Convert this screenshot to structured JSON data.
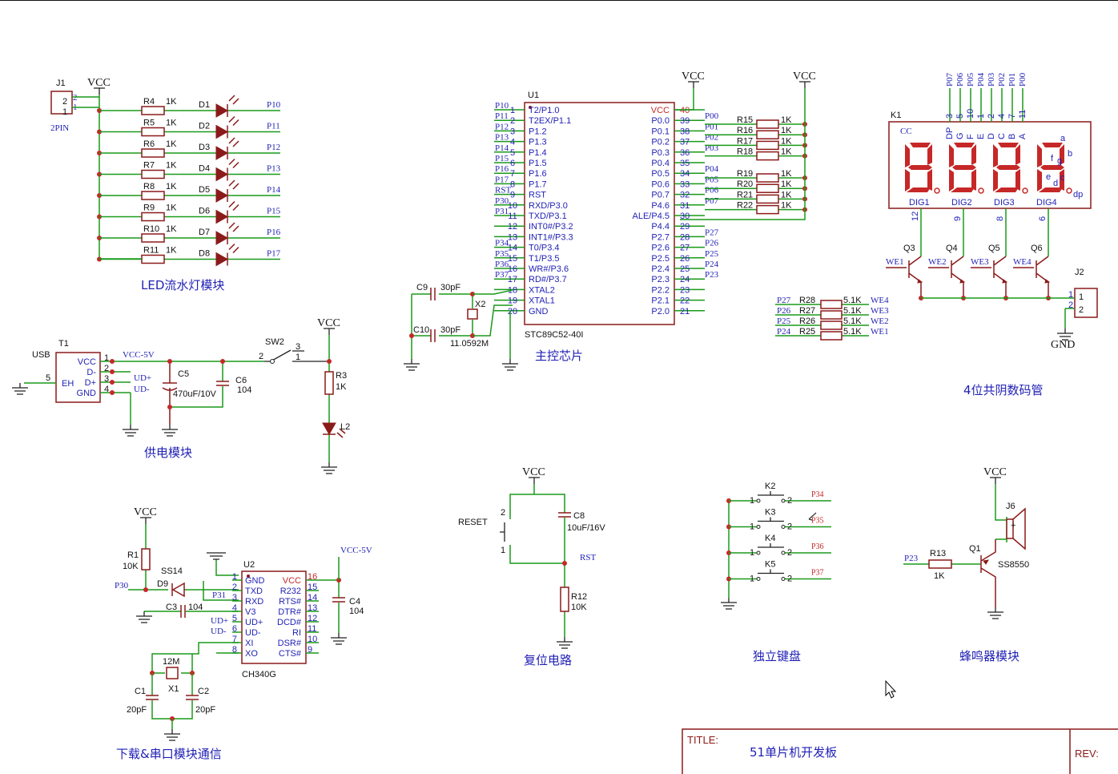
{
  "labels": {
    "vcc": "VCC",
    "gnd": "GND",
    "title_label": "TITLE:",
    "title_value": "51单片机开发板",
    "rev_label": "REV:"
  },
  "modules": {
    "led": "LED流水灯模块",
    "power": "供电模块",
    "main": "主控芯片",
    "seg": "4位共阴数码管",
    "download": "下载&串口模块通信",
    "reset": "复位电路",
    "keys": "独立键盘",
    "buzzer": "蜂鸣器模块"
  },
  "led_module": {
    "connector": {
      "ref": "J1",
      "name": "2PIN",
      "pin2": "2",
      "pin1": "1",
      "p2": "2",
      "p1": "1"
    },
    "rows": [
      {
        "r": "R4",
        "v": "1K",
        "d": "D1",
        "net": "P10"
      },
      {
        "r": "R5",
        "v": "1K",
        "d": "D2",
        "net": "P11"
      },
      {
        "r": "R6",
        "v": "1K",
        "d": "D3",
        "net": "P12"
      },
      {
        "r": "R7",
        "v": "1K",
        "d": "D4",
        "net": "P13"
      },
      {
        "r": "R8",
        "v": "1K",
        "d": "D5",
        "net": "P14"
      },
      {
        "r": "R9",
        "v": "1K",
        "d": "D6",
        "net": "P15"
      },
      {
        "r": "R10",
        "v": "1K",
        "d": "D7",
        "net": "P16"
      },
      {
        "r": "R11",
        "v": "1K",
        "d": "D8",
        "net": "P17"
      }
    ]
  },
  "mcu": {
    "ref": "U1",
    "part": "STC89C52-40I",
    "left": [
      {
        "net": "P10",
        "n": "1",
        "name": "T2/P1.0"
      },
      {
        "net": "P11",
        "n": "2",
        "name": "T2EX/P1.1"
      },
      {
        "net": "P12",
        "n": "3",
        "name": "P1.2"
      },
      {
        "net": "P13",
        "n": "4",
        "name": "P1.3"
      },
      {
        "net": "P14",
        "n": "5",
        "name": "P1.4"
      },
      {
        "net": "P15",
        "n": "6",
        "name": "P1.5"
      },
      {
        "net": "P16",
        "n": "7",
        "name": "P1.6"
      },
      {
        "net": "P17",
        "n": "8",
        "name": "P1.7"
      },
      {
        "net": "RST",
        "n": "9",
        "name": "RST"
      },
      {
        "net": "P30",
        "n": "10",
        "name": "RXD/P3.0"
      },
      {
        "net": "P31",
        "n": "11",
        "name": "TXD/P3.1"
      },
      {
        "net": "",
        "n": "12",
        "name": "INT0#/P3.2"
      },
      {
        "net": "",
        "n": "13",
        "name": "INT1#/P3.3"
      },
      {
        "net": "P34",
        "n": "14",
        "name": "T0/P3.4"
      },
      {
        "net": "P35",
        "n": "15",
        "name": "T1/P3.5"
      },
      {
        "net": "P36",
        "n": "16",
        "name": "WR#/P3.6"
      },
      {
        "net": "P37",
        "n": "17",
        "name": "RD#/P3.7"
      },
      {
        "net": "",
        "n": "18",
        "name": "XTAL2"
      },
      {
        "net": "",
        "n": "19",
        "name": "XTAL1"
      },
      {
        "net": "",
        "n": "20",
        "name": "GND"
      }
    ],
    "right": [
      {
        "net": "",
        "n": "40",
        "name": "VCC"
      },
      {
        "net": "P00",
        "n": "39",
        "name": "P0.0"
      },
      {
        "net": "P01",
        "n": "38",
        "name": "P0.1"
      },
      {
        "net": "P02",
        "n": "37",
        "name": "P0.2"
      },
      {
        "net": "P03",
        "n": "36",
        "name": "P0.3"
      },
      {
        "net": "",
        "n": "35",
        "name": "P0.4"
      },
      {
        "net": "P04",
        "n": "34",
        "name": "P0.5"
      },
      {
        "net": "P05",
        "n": "33",
        "name": "P0.6"
      },
      {
        "net": "P06",
        "n": "32",
        "name": "P0.7"
      },
      {
        "net": "P07",
        "n": "31",
        "name": "P4.6"
      },
      {
        "net": "",
        "n": "30",
        "name": "ALE/P4.5"
      },
      {
        "net": "",
        "n": "29",
        "name": "P4.4"
      },
      {
        "net": "P27",
        "n": "28",
        "name": "P2.7"
      },
      {
        "net": "P26",
        "n": "27",
        "name": "P2.6"
      },
      {
        "net": "P25",
        "n": "26",
        "name": "P2.5"
      },
      {
        "net": "P24",
        "n": "25",
        "name": "P2.4"
      },
      {
        "net": "P23",
        "n": "24",
        "name": "P2.3"
      },
      {
        "net": "",
        "n": "23",
        "name": "P2.2"
      },
      {
        "net": "",
        "n": "22",
        "name": "P2.1"
      },
      {
        "net": "",
        "n": "21",
        "name": "P2.0"
      }
    ],
    "crystal": {
      "c9": "C9",
      "c9v": "30pF",
      "c10": "C10",
      "c10v": "30pF",
      "x": "X2",
      "xv": "11.0592M"
    },
    "pullups": [
      {
        "r": "R15",
        "v": "1K"
      },
      {
        "r": "R16",
        "v": "1K"
      },
      {
        "r": "R17",
        "v": "1K"
      },
      {
        "r": "R18",
        "v": "1K"
      },
      {
        "r": "R19",
        "v": "1K"
      },
      {
        "r": "R20",
        "v": "1K"
      },
      {
        "r": "R21",
        "v": "1K"
      },
      {
        "r": "R22",
        "v": "1K"
      }
    ]
  },
  "seg_module": {
    "ref": "K1",
    "cc": "CC",
    "top_nets": [
      "P07",
      "P06",
      "P05",
      "P04",
      "P03",
      "P02",
      "P01",
      "P00"
    ],
    "top_pins": [
      "3",
      "5",
      "10",
      "1",
      "2",
      "4",
      "7",
      "11"
    ],
    "top_names": [
      "DP",
      "G",
      "F",
      "E",
      "D",
      "C",
      "B",
      "A"
    ],
    "seg_letters": {
      "a": "a",
      "b": "b",
      "c": "c",
      "d": "d",
      "e": "e",
      "f": "f",
      "g": "g",
      "dp": "dp"
    },
    "digits": [
      {
        "name": "DIG1",
        "pin": "12",
        "q": "Q3",
        "we": "WE1"
      },
      {
        "name": "DIG2",
        "pin": "9",
        "q": "Q4",
        "we": "WE2"
      },
      {
        "name": "DIG3",
        "pin": "8",
        "q": "Q5",
        "we": "WE3"
      },
      {
        "name": "DIG4",
        "pin": "6",
        "q": "Q6",
        "we": "WE4"
      }
    ],
    "j2": {
      "ref": "J2",
      "p1": "1",
      "p2": "2",
      "pin1": "1",
      "pin2": "2"
    },
    "resistors": [
      {
        "net": "P27",
        "r": "R28",
        "v": "5.1K",
        "we": "WE4"
      },
      {
        "net": "P26",
        "r": "R27",
        "v": "5.1K",
        "we": "WE3"
      },
      {
        "net": "P25",
        "r": "R26",
        "v": "5.1K",
        "we": "WE2"
      },
      {
        "net": "P24",
        "r": "R25",
        "v": "5.1K",
        "we": "WE1"
      }
    ]
  },
  "power_module": {
    "t1": "T1",
    "usb": "USB",
    "pins": [
      {
        "n": "1",
        "name": "VCC"
      },
      {
        "n": "2",
        "name": "D-"
      },
      {
        "n": "3",
        "name": "D+"
      },
      {
        "n": "4",
        "name": "GND"
      }
    ],
    "eh": "EH",
    "eh_pin": "5",
    "vcc5": "VCC-5V",
    "udp": "UD+",
    "udm": "UD-",
    "c5": "C5",
    "c5v": "470uF/10V",
    "c6": "C6",
    "c6v": "104",
    "sw": "SW2",
    "sw_p1": "1",
    "sw_p2": "2",
    "sw_p3": "3",
    "r3": "R3",
    "r3v": "1K",
    "l2": "L2"
  },
  "download_module": {
    "r1": "R1",
    "r1v": "10K",
    "d9": "D9",
    "d9p": "SS14",
    "p30": "P30",
    "p31": "P31",
    "c3": "C3",
    "c3v": "104",
    "u2": "U2",
    "part": "CH340G",
    "left": [
      {
        "n": "1",
        "name": "GND",
        "net": ""
      },
      {
        "n": "2",
        "name": "TXD",
        "net": ""
      },
      {
        "n": "3",
        "name": "RXD",
        "net": "P31"
      },
      {
        "n": "4",
        "name": "V3",
        "net": ""
      },
      {
        "n": "5",
        "name": "UD+",
        "net": "UD+"
      },
      {
        "n": "6",
        "name": "UD-",
        "net": "UD-"
      },
      {
        "n": "7",
        "name": "XI",
        "net": ""
      },
      {
        "n": "8",
        "name": "XO",
        "net": ""
      }
    ],
    "right": [
      {
        "n": "16",
        "name": "VCC"
      },
      {
        "n": "15",
        "name": "R232"
      },
      {
        "n": "14",
        "name": "RTS#"
      },
      {
        "n": "13",
        "name": "DTR#"
      },
      {
        "n": "12",
        "name": "DCD#"
      },
      {
        "n": "11",
        "name": "RI"
      },
      {
        "n": "10",
        "name": "DSR#"
      },
      {
        "n": "9",
        "name": "CTS#"
      }
    ],
    "vcc5": "VCC-5V",
    "c4": "C4",
    "c4v": "104",
    "x1": "X1",
    "x1v": "12M",
    "c1": "C1",
    "c1v": "20pF",
    "c2": "C2",
    "c2v": "20pF"
  },
  "reset_module": {
    "reset": "RESET",
    "p1": "1",
    "p2": "2",
    "c8": "C8",
    "c8v": "10uF/16V",
    "rst": "RST",
    "r12": "R12",
    "r12v": "10K"
  },
  "keys_module": {
    "keys": [
      {
        "k": "K2",
        "net": "P34"
      },
      {
        "k": "K3",
        "net": "P35"
      },
      {
        "k": "K4",
        "net": "P36"
      },
      {
        "k": "K5",
        "net": "P37"
      }
    ],
    "p1": "1",
    "p2": "2"
  },
  "buzzer_module": {
    "p23": "P23",
    "r13": "R13",
    "r13v": "1K",
    "q1": "Q1",
    "q1p": "SS8550",
    "j6": "J6",
    "plus": "+"
  }
}
